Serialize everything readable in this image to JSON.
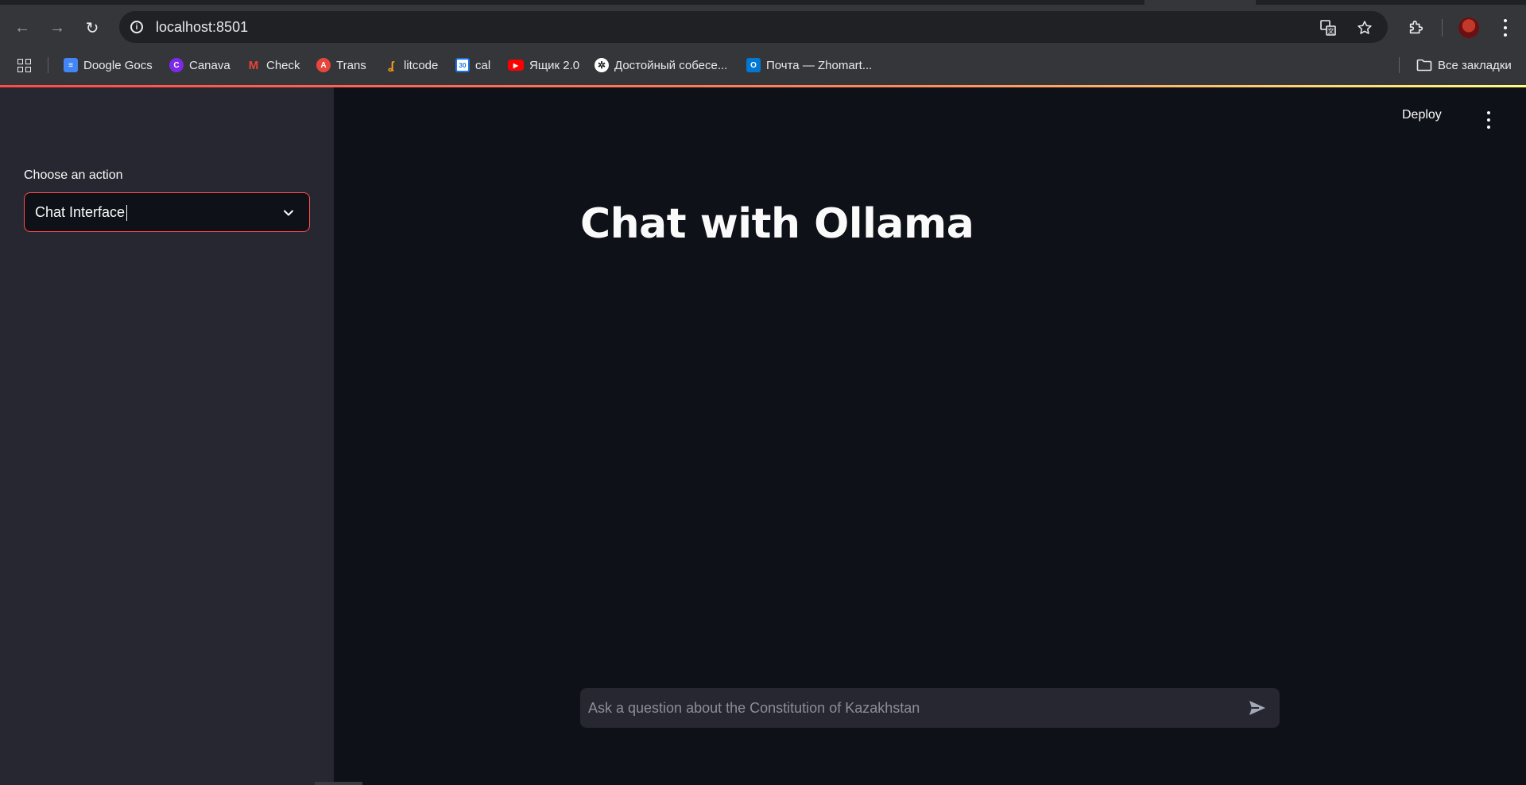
{
  "browser": {
    "url": "localhost:8501",
    "bookmarks": [
      {
        "label": "Doogle Gocs",
        "icon": "docs-icon",
        "color": "#4285f4"
      },
      {
        "label": "Canava",
        "icon": "canva-icon",
        "color": "#7d2ae8"
      },
      {
        "label": "Check",
        "icon": "gmail-icon",
        "color": "#ea4335"
      },
      {
        "label": "Trans",
        "icon": "translate-icon",
        "color": "#e8453c"
      },
      {
        "label": "litcode",
        "icon": "leetcode-icon",
        "color": "#ffa116"
      },
      {
        "label": "cal",
        "icon": "calendar-icon",
        "color": "#1a73e8"
      },
      {
        "label": "Ящик 2.0",
        "icon": "youtube-icon",
        "color": "#ff0000"
      },
      {
        "label": "Достойный собесе...",
        "icon": "openai-icon",
        "color": "#ffffff"
      },
      {
        "label": "Почта — Zhomart...",
        "icon": "outlook-icon",
        "color": "#0078d4"
      }
    ],
    "all_bookmarks_label": "Все закладки",
    "calendar_badge": "30"
  },
  "sidebar": {
    "select_label": "Choose an action",
    "select_value": "Chat Interface"
  },
  "header": {
    "deploy_label": "Deploy"
  },
  "main": {
    "title": "Chat with Ollama",
    "chat_placeholder": "Ask a question about the Constitution of Kazakhstan"
  },
  "colors": {
    "primary": "#ff4b4b",
    "background": "#0e1117",
    "sidebar": "#262730",
    "text": "#fafafa"
  }
}
